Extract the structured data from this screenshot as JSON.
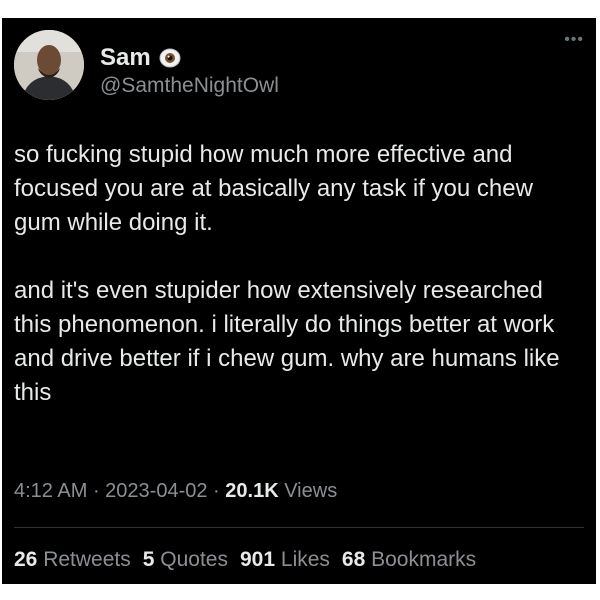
{
  "author": {
    "display_name": "Sam",
    "handle": "@SamtheNightOwl",
    "badge_icon": "eye-icon"
  },
  "more_icon": "ellipsis-icon",
  "tweet": {
    "paragraphs": [
      "so fucking stupid how much more effective and focused you are at basically any task if you chew gum while doing it.",
      "and it's even stupider how extensively researched this phenomenon. i literally do things better at work and drive better if i chew gum. why are humans like this"
    ]
  },
  "meta": {
    "time": "4:12 AM",
    "date": "2023-04-02",
    "separator": " · ",
    "views_count": "20.1K",
    "views_label": "Views"
  },
  "stats": {
    "retweets": {
      "count": "26",
      "label": "Retweets"
    },
    "quotes": {
      "count": "5",
      "label": "Quotes"
    },
    "likes": {
      "count": "901",
      "label": "Likes"
    },
    "bookmarks": {
      "count": "68",
      "label": "Bookmarks"
    }
  },
  "colors": {
    "background": "#000000",
    "text": "#e7e9ea",
    "muted": "#8b8f94",
    "divider": "#2f3336"
  }
}
